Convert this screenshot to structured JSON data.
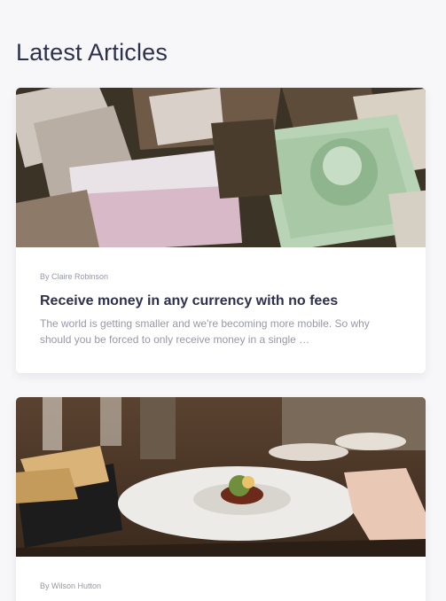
{
  "section": {
    "title": "Latest Articles"
  },
  "articles": [
    {
      "author": "By Claire Robinson",
      "title": "Receive money in any currency with no fees",
      "excerpt": "The world is getting smaller and we're becoming more mobile. So why should you be forced to only receive money in a single …",
      "image_subject": "currency-notes"
    },
    {
      "author": "By Wilson Hutton",
      "image_subject": "restaurant-dish"
    }
  ]
}
